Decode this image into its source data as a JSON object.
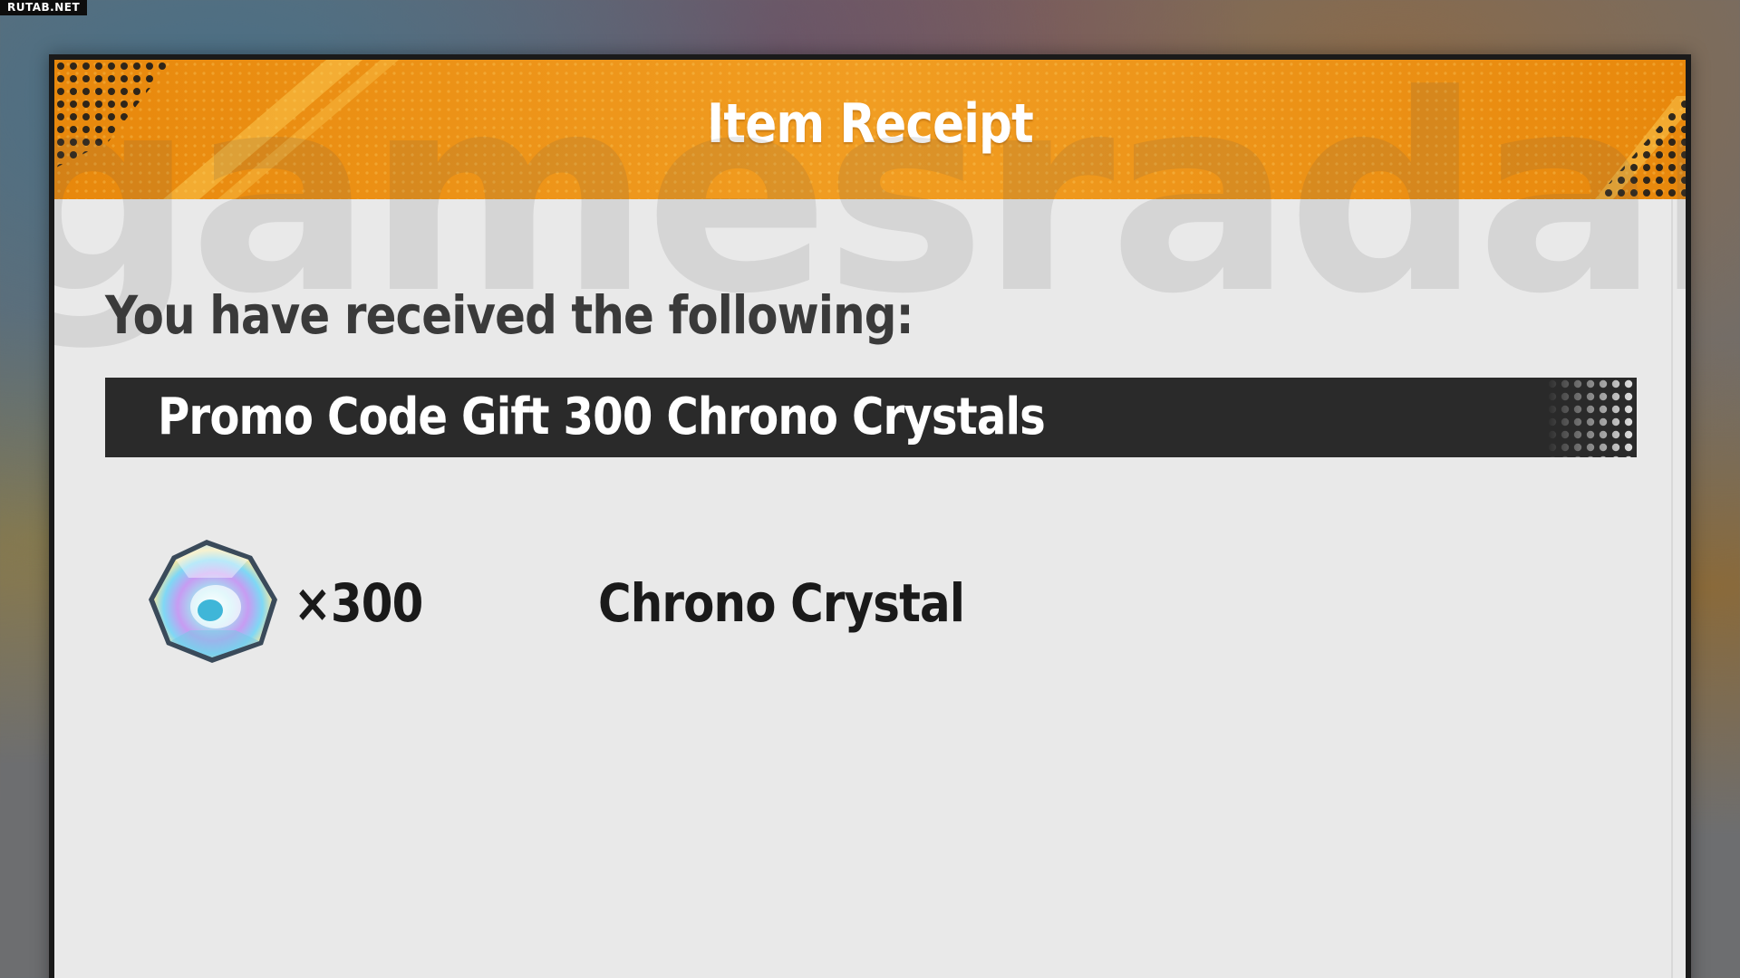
{
  "site_tag": "RUTAB.NET",
  "watermark": "gamesradar+",
  "dialog": {
    "title": "Item Receipt",
    "subtitle": "You have received the following:",
    "gift_label": "Promo Code Gift 300 Chrono Crystals",
    "reward": {
      "icon": "chrono-crystal-icon",
      "quantity": "×300",
      "name": "Chrono Crystal"
    }
  },
  "colors": {
    "header_orange": "#f09a1e",
    "header_orange_dark": "#e07f08",
    "panel_bg": "#e9e9e9",
    "bar_bg": "#2a2a2a",
    "frame": "#1a1a1a"
  }
}
